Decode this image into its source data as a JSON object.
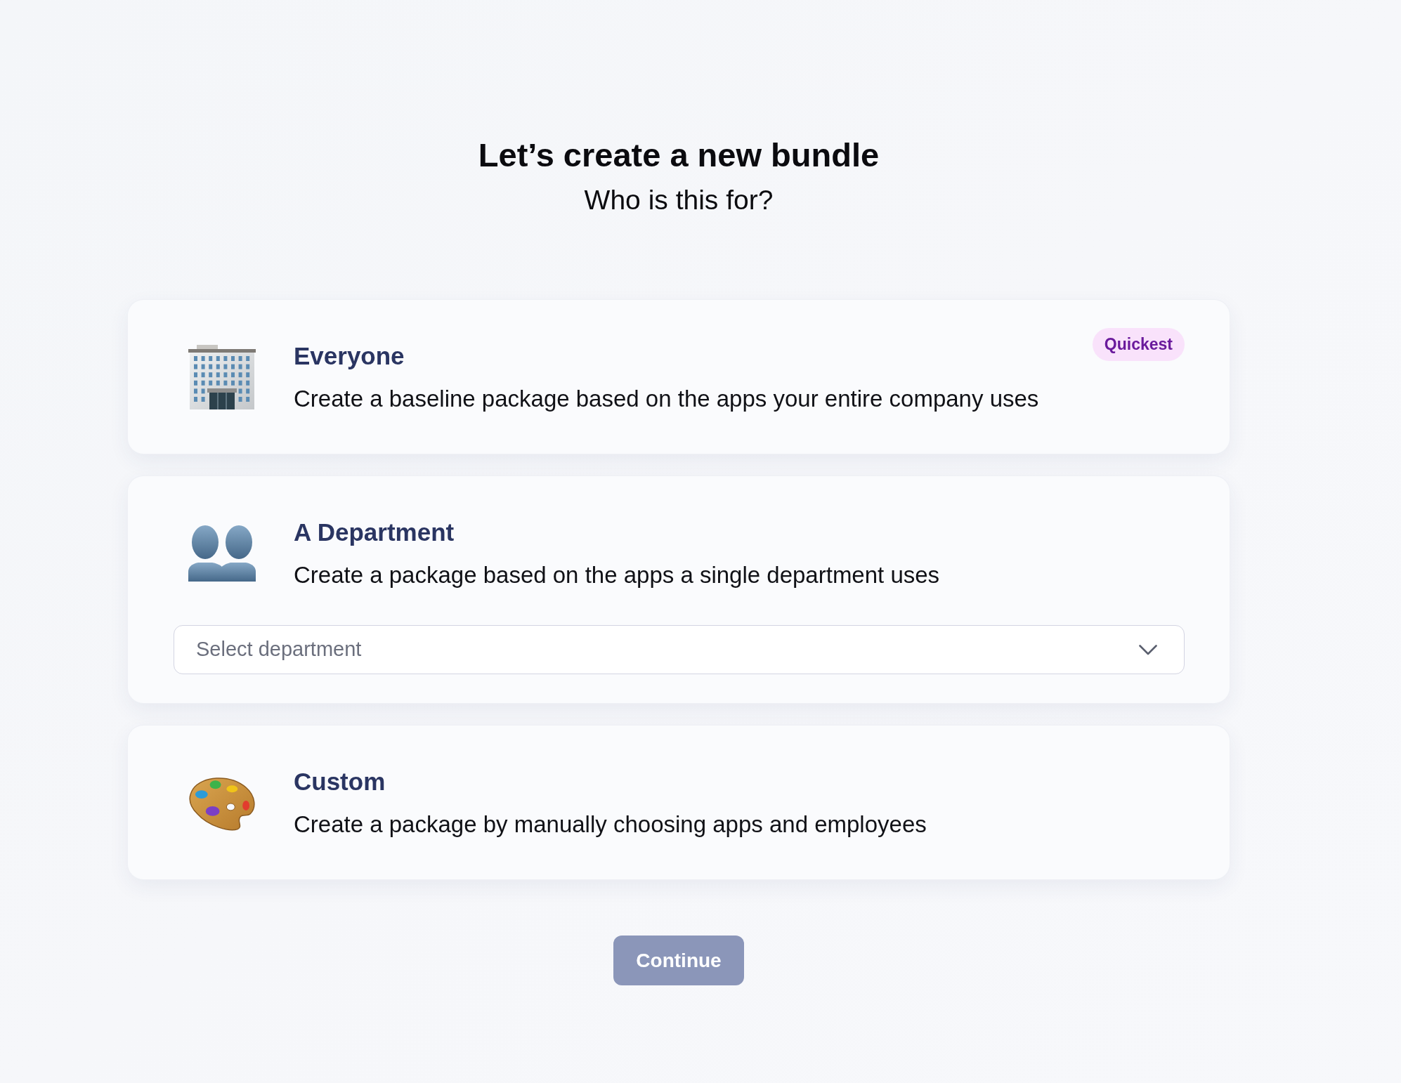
{
  "header": {
    "title": "Let’s create a new bundle",
    "subtitle": "Who is this for?"
  },
  "options": [
    {
      "kind": "company",
      "title": "Everyone",
      "description": "Create a baseline package based on the apps your entire company uses",
      "badge": "Quickest",
      "selected": false
    },
    {
      "kind": "department",
      "title": "A Department",
      "description": "Create a package based on the apps a single department uses",
      "select": {
        "placeholder": "Select department"
      },
      "selected": false
    },
    {
      "kind": "custom",
      "title": "Custom",
      "description": "Create a package by manually choosing apps and employees",
      "selected": false
    }
  ],
  "continue_button": {
    "label": "Continue",
    "disabled": true
  }
}
